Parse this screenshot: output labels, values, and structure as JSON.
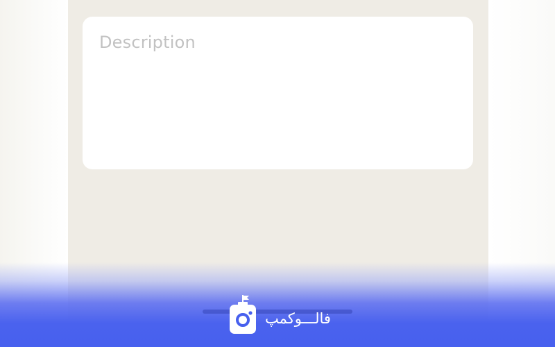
{
  "form": {
    "description_placeholder": "Description"
  },
  "watermark": {
    "brand_text": "فالـــوکمپ"
  },
  "colors": {
    "screen_background": "#efece5",
    "card_background": "#ffffff",
    "placeholder_text": "#c2c2c2",
    "brand_blue": "#4760ee"
  }
}
